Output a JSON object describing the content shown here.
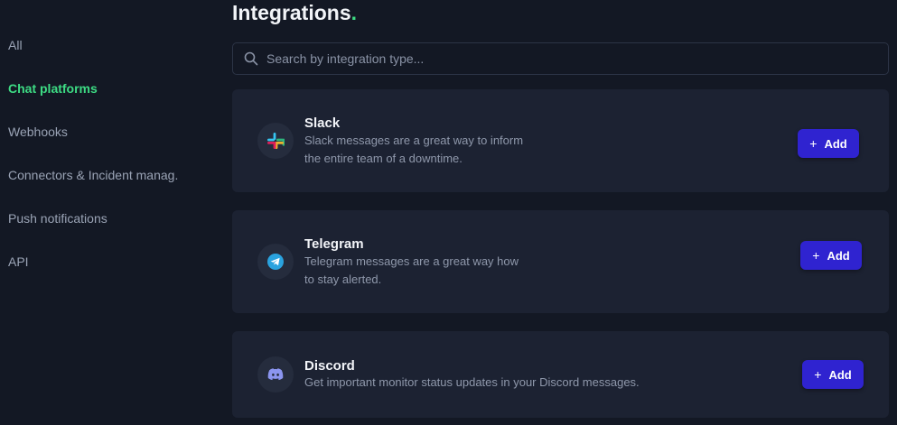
{
  "page": {
    "title": "Integrations",
    "title_dot": "."
  },
  "sidebar": {
    "items": [
      {
        "label": "All",
        "active": false
      },
      {
        "label": "Chat platforms",
        "active": true
      },
      {
        "label": "Webhooks",
        "active": false
      },
      {
        "label": "Connectors & Incident manag.",
        "active": false
      },
      {
        "label": "Push notifications",
        "active": false
      },
      {
        "label": "API",
        "active": false
      }
    ]
  },
  "search": {
    "placeholder": "Search by integration type...",
    "value": ""
  },
  "integrations": [
    {
      "name": "Slack",
      "icon": "slack-icon",
      "description_line1": "Slack messages are a great way to inform",
      "description_line2": "the entire team of a downtime.",
      "button_label": "Add"
    },
    {
      "name": "Telegram",
      "icon": "telegram-icon",
      "description_line1": "Telegram messages are a great way how",
      "description_line2": "to stay alerted.",
      "button_label": "Add"
    },
    {
      "name": "Discord",
      "icon": "discord-icon",
      "description_line1": "Get important monitor status updates in your Discord messages.",
      "description_line2": "",
      "button_label": "Add"
    }
  ],
  "colors": {
    "background": "#131824",
    "card": "#1c2232",
    "accent_green": "#3ddc84",
    "button": "#2f23d0"
  }
}
